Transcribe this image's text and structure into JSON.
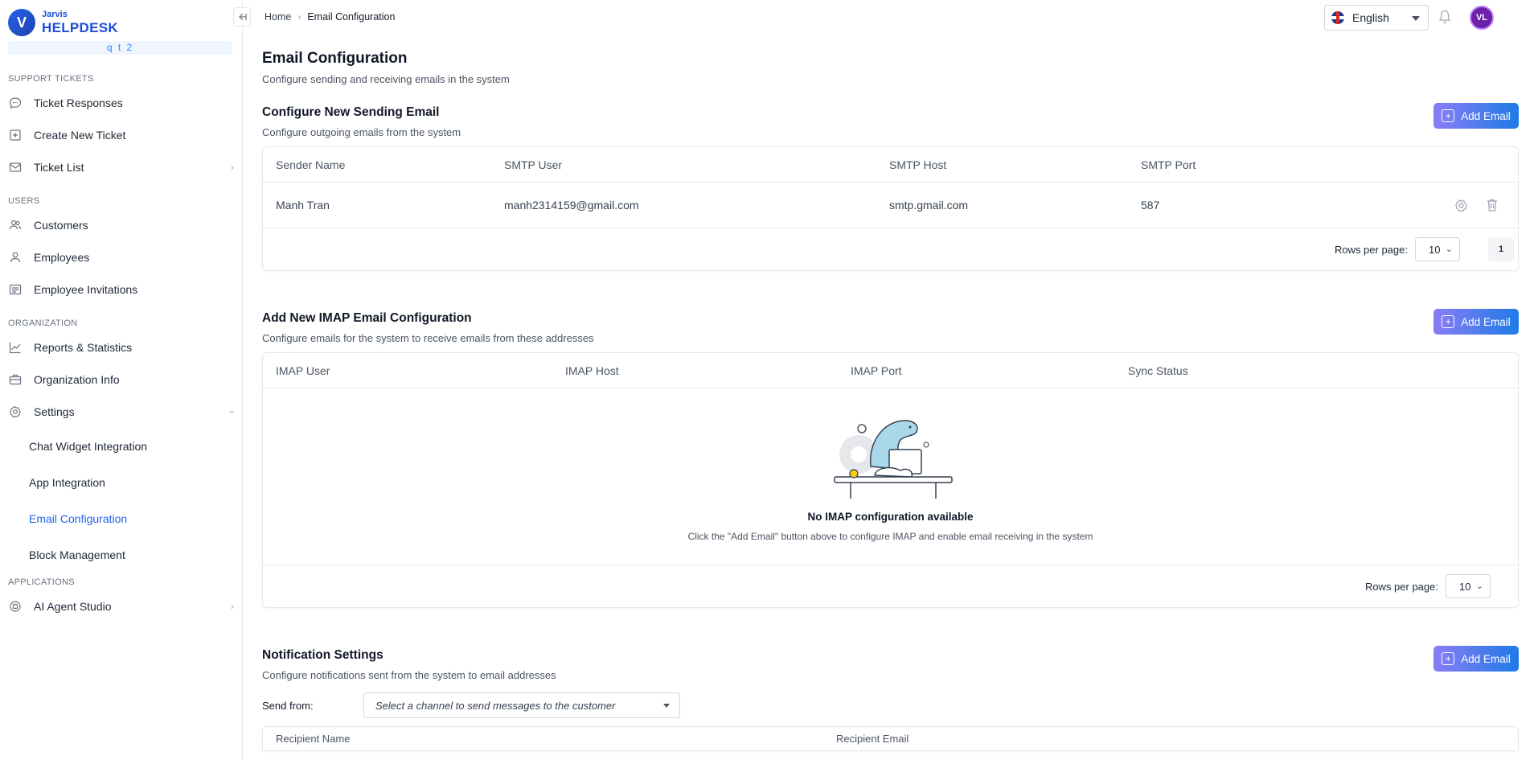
{
  "brand": {
    "small": "Jarvis",
    "big": "HELPDESK",
    "logo_letter": "V",
    "org": "q t 2"
  },
  "sidebar": {
    "sections": {
      "support": "SUPPORT TICKETS",
      "users": "USERS",
      "organization": "ORGANIZATION",
      "applications": "APPLICATIONS"
    },
    "items": {
      "ticket_responses": "Ticket Responses",
      "create_ticket": "Create New Ticket",
      "ticket_list": "Ticket List",
      "customers": "Customers",
      "employees": "Employees",
      "employee_invitations": "Employee Invitations",
      "reports": "Reports & Statistics",
      "org_info": "Organization Info",
      "settings": "Settings",
      "chat_widget": "Chat Widget Integration",
      "app_integration": "App Integration",
      "email_config": "Email Configuration",
      "block_mgmt": "Block Management",
      "ai_agent": "AI Agent Studio"
    }
  },
  "topbar": {
    "breadcrumb_home": "Home",
    "breadcrumb_sep": "›",
    "breadcrumb_current": "Email Configuration",
    "language": "English",
    "avatar_initials": "VL"
  },
  "page": {
    "title": "Email Configuration",
    "subtitle": "Configure sending and receiving emails in the system"
  },
  "sending": {
    "title": "Configure New Sending Email",
    "subtitle": "Configure outgoing emails from the system",
    "add_label": "Add Email",
    "columns": [
      "Sender Name",
      "SMTP User",
      "SMTP Host",
      "SMTP Port"
    ],
    "rows": [
      {
        "sender": "Manh Tran",
        "user": "manh2314159@gmail.com",
        "host": "smtp.gmail.com",
        "port": "587"
      }
    ],
    "rows_per_page_label": "Rows per page:",
    "rows_per_page": "10",
    "page": "1"
  },
  "imap": {
    "title": "Add New IMAP Email Configuration",
    "subtitle": "Configure emails for the system to receive emails from these addresses",
    "add_label": "Add Email",
    "columns": [
      "IMAP User",
      "IMAP Host",
      "IMAP Port",
      "Sync Status"
    ],
    "empty_title": "No IMAP configuration available",
    "empty_sub": "Click the \"Add Email\" button above to configure IMAP and enable email receiving in the system",
    "rows_per_page_label": "Rows per page:",
    "rows_per_page": "10"
  },
  "notification": {
    "title": "Notification Settings",
    "subtitle": "Configure notifications sent from the system to email addresses",
    "add_label": "Add Email",
    "send_from_label": "Send from:",
    "send_from_placeholder": "Select a channel to send messages to the customer",
    "columns": [
      "Recipient Name",
      "Recipient Email"
    ]
  }
}
